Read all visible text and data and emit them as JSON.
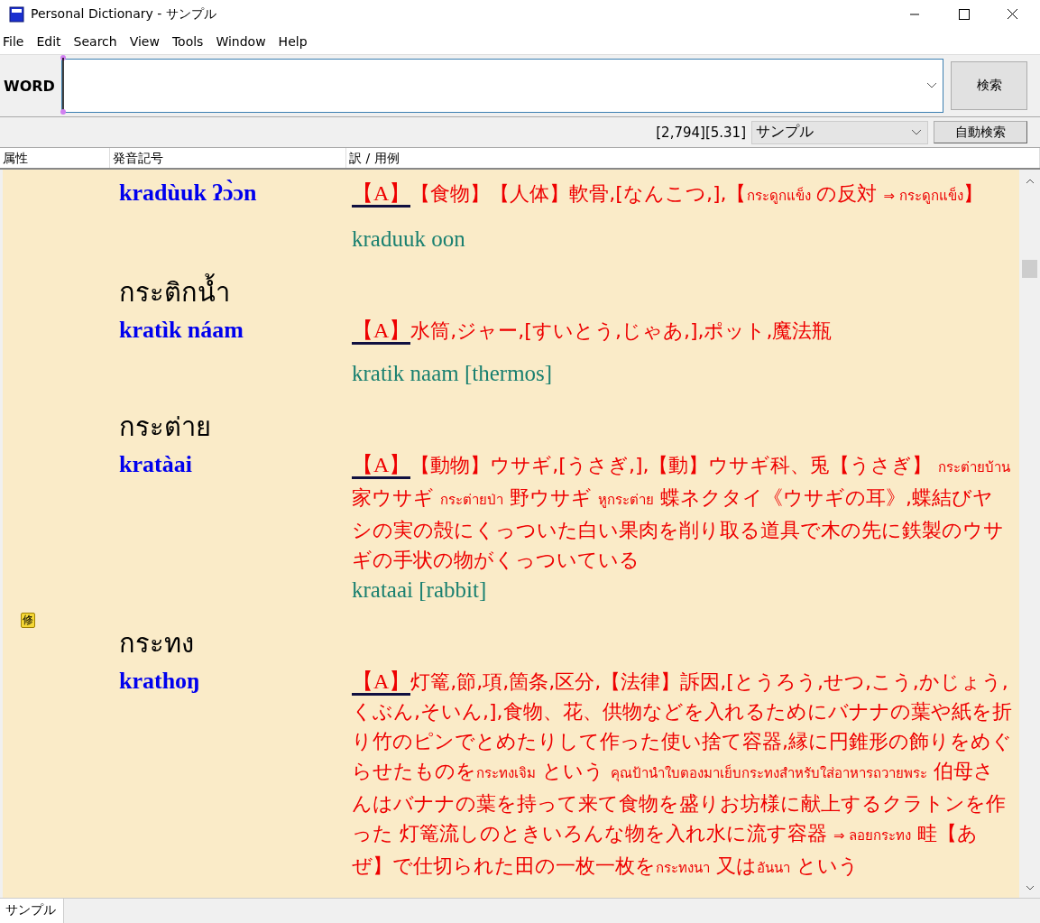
{
  "window": {
    "title": "Personal Dictionary - サンプル"
  },
  "menu": [
    "File",
    "Edit",
    "Search",
    "View",
    "Tools",
    "Window",
    "Help"
  ],
  "search": {
    "label": "WORD",
    "button": "検索"
  },
  "status": {
    "counts": "[2,794][5.31]",
    "dictionary": "サンプル",
    "auto_button": "自動検索"
  },
  "columns": [
    "属性",
    "発音記号",
    "訳 / 用例"
  ],
  "entries": [
    {
      "pronunciation": "kradùuk ʔɔ̀ɔn",
      "translation": [
        {
          "kind": "tag",
          "text": "【A】"
        },
        {
          "kind": "ja",
          "text": "【食物】【人体】軟骨,[なんこつ,],【"
        },
        {
          "kind": "th",
          "text": "กระดูกแข็ง"
        },
        {
          "kind": "ja",
          "text": " の反対 "
        },
        {
          "kind": "th",
          "text": "⇒ กระดูกแข็ง"
        },
        {
          "kind": "ja",
          "text": "】"
        }
      ],
      "example": "kraduuk oon"
    },
    {
      "headword": "กระติกน้ำ",
      "pronunciation": "kratìk náam",
      "translation": [
        {
          "kind": "tag",
          "text": "【A】"
        },
        {
          "kind": "ja",
          "text": "水筒,ジャー,[すいとう,じゃあ,],ポット,魔法瓶"
        }
      ],
      "example": "kratik naam [thermos]"
    },
    {
      "headword": "กระต่าย",
      "pronunciation": "kratàai",
      "translation": [
        {
          "kind": "tag",
          "text": "【A】"
        },
        {
          "kind": "ja",
          "text": "【動物】ウサギ,[うさぎ,],【動】ウサギ科、兎【うさぎ】 "
        },
        {
          "kind": "th",
          "text": "กระต่ายบ้าน"
        },
        {
          "kind": "ja",
          "text": " 家ウサギ "
        },
        {
          "kind": "th",
          "text": "กระต่ายป่า"
        },
        {
          "kind": "ja",
          "text": " 野ウサギ "
        },
        {
          "kind": "th",
          "text": "หูกระต่าย"
        },
        {
          "kind": "ja",
          "text": " 蝶ネクタイ《ウサギの耳》,蝶結びヤシの実の殻にくっついた白い果肉を削り取る道具で木の先に鉄製のウサギの手状の物がくっついている"
        }
      ],
      "example": "krataai [rabbit]"
    },
    {
      "mark": "修",
      "headword": "กระทง",
      "pronunciation": "krathoŋ",
      "translation": [
        {
          "kind": "tag",
          "text": "【A】"
        },
        {
          "kind": "ja",
          "text": "灯篭,節,項,箇条,区分,【法律】訴因,[とうろう,せつ,こう,かじょう,くぶん,そいん,],食物、花、供物などを入れるためにバナナの葉や紙を折り竹のピンでとめたりして作った使い捨て容器,縁に円錐形の飾りをめぐらせたものを"
        },
        {
          "kind": "th",
          "text": "กระทงเจิม"
        },
        {
          "kind": "ja",
          "text": " という "
        },
        {
          "kind": "th",
          "text": "คุณป้านำใบตองมาเย็บกระทงสำหรับใส่อาหารถวายพระ"
        },
        {
          "kind": "ja",
          "text": " 伯母さんはバナナの葉を持って来て食物を盛りお坊様に献上するクラトンを作った 灯篭流しのときいろんな物を入れ水に流す容器 "
        },
        {
          "kind": "th",
          "text": "⇒ ลอยกระทง"
        },
        {
          "kind": "ja",
          "text": " 畦【あぜ】で仕切られた田の一枚一枚を"
        },
        {
          "kind": "th",
          "text": "กระทงนา"
        },
        {
          "kind": "ja",
          "text": " 又は"
        },
        {
          "kind": "th",
          "text": "อันนา"
        },
        {
          "kind": "ja",
          "text": " という"
        }
      ]
    }
  ],
  "bottom_tabs": [
    {
      "label": "サンプル",
      "selected": true
    }
  ]
}
